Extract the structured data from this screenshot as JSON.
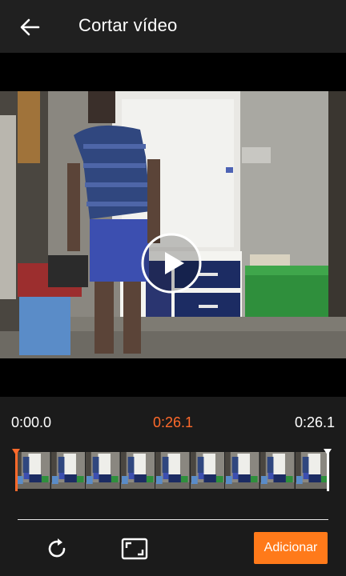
{
  "appbar": {
    "title": "Cortar vídeo",
    "back_icon": "arrow-left-icon"
  },
  "player": {
    "play_icon": "play-icon"
  },
  "timeline": {
    "start_time": "0:00.0",
    "current_time": "0:26.1",
    "end_time": "0:26.1",
    "frame_count": 9
  },
  "toolbar": {
    "rotate_icon": "rotate-icon",
    "aspect_icon": "aspect-ratio-icon",
    "add_label": "Adicionar"
  },
  "colors": {
    "accent": "#ff6a2b",
    "button": "#ff7a1a",
    "background": "#1b1b1b"
  }
}
